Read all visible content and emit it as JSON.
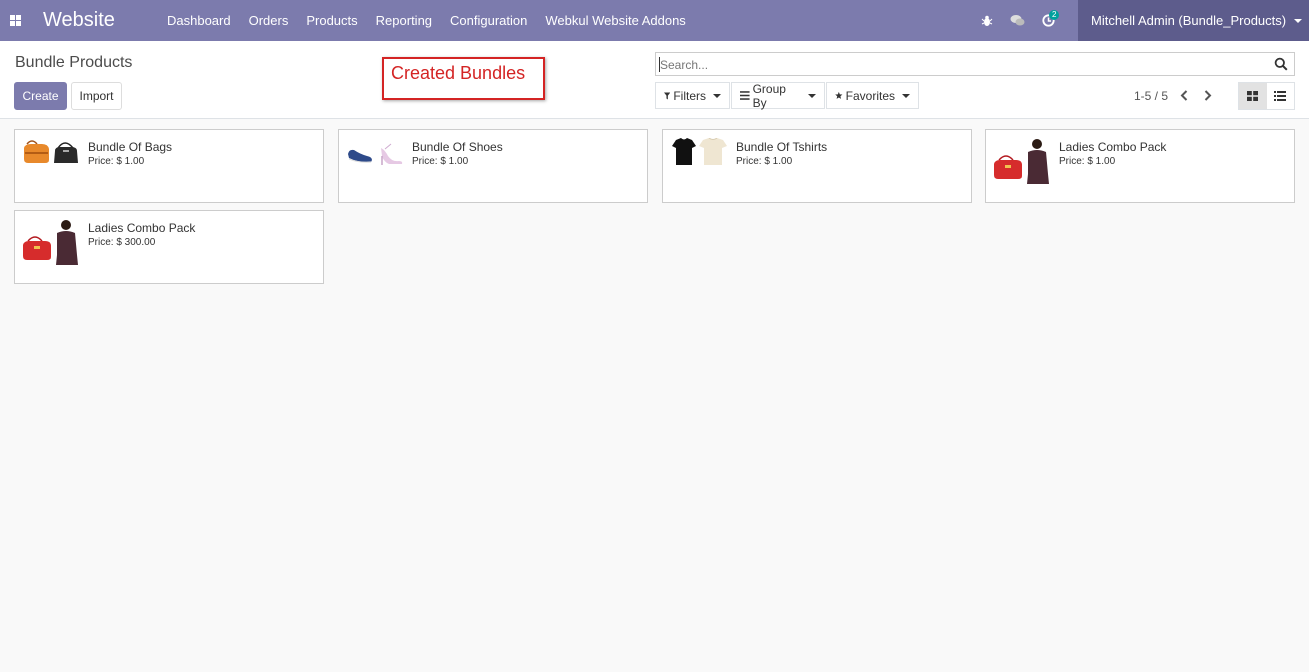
{
  "navbar": {
    "brand": "Website",
    "menu": [
      "Dashboard",
      "Orders",
      "Products",
      "Reporting",
      "Configuration",
      "Webkul Website Addons"
    ],
    "activity_badge": "2",
    "user": "Mitchell Admin (Bundle_Products)"
  },
  "control_panel": {
    "title": "Bundle Products",
    "create_label": "Create",
    "import_label": "Import",
    "search_placeholder": "Search...",
    "filters_label": "Filters",
    "group_by_label": "Group By",
    "favorites_label": "Favorites",
    "pager": "1-5 / 5",
    "view_modes": [
      "kanban",
      "list"
    ],
    "active_view": "kanban"
  },
  "annotation": {
    "text": "Created Bundles",
    "color": "#d42424"
  },
  "colors": {
    "navbar": "#7c7bad",
    "user_area": "#5d5c8c",
    "primary": "#7c7bad",
    "badge": "#00a09d"
  },
  "products": [
    {
      "name": "Bundle Of Bags",
      "price": "Price: $ 1.00",
      "thumbnails": [
        "orange-bag-icon",
        "black-handbag-icon"
      ]
    },
    {
      "name": "Bundle Of Shoes",
      "price": "Price: $ 1.00",
      "thumbnails": [
        "blue-shoe-icon",
        "pink-heel-icon"
      ]
    },
    {
      "name": "Bundle Of Tshirts",
      "price": "Price: $ 1.00",
      "thumbnails": [
        "black-tshirt-icon",
        "beige-tshirt-icon"
      ]
    },
    {
      "name": "Ladies Combo Pack",
      "price": "Price: $ 1.00",
      "thumbnails": [
        "red-handbag-icon",
        "woman-top-icon"
      ]
    },
    {
      "name": "Ladies Combo Pack",
      "price": "Price: $ 300.00",
      "thumbnails": [
        "red-handbag-icon",
        "woman-top-icon"
      ]
    }
  ]
}
